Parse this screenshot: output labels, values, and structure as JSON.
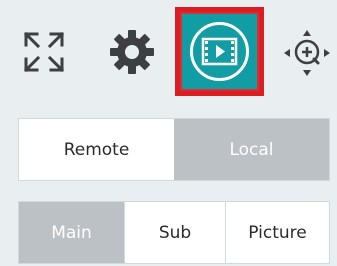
{
  "toolbar": {
    "buttons": [
      {
        "icon": "fullscreen-icon",
        "selected": false
      },
      {
        "icon": "gear-icon",
        "selected": false
      },
      {
        "icon": "video-playback-icon",
        "selected": true
      },
      {
        "icon": "ptz-control-icon",
        "selected": false
      }
    ],
    "colors": {
      "icon": "#3e3f40",
      "selected_bg": "#129da4",
      "selected_border": "#dc1e24"
    }
  },
  "source_toggle": {
    "options": [
      "Remote",
      "Local"
    ],
    "selected": "Local"
  },
  "stream_toggle": {
    "options": [
      "Main",
      "Sub",
      "Picture"
    ],
    "selected": "Main"
  },
  "colors": {
    "background": "#e9eef1",
    "active_segment": "#bcc1c5",
    "text": "#2b2b2b"
  }
}
